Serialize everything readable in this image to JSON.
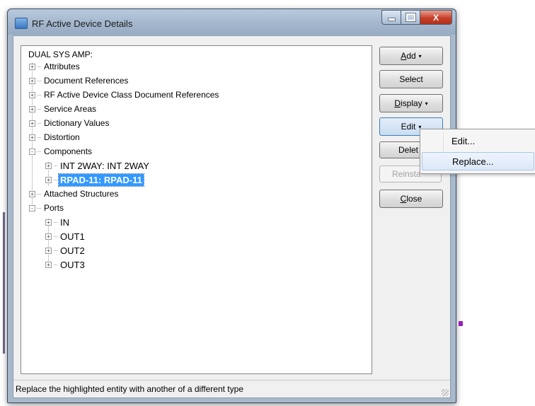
{
  "window": {
    "title": "RF Active Device Details",
    "controls": {
      "minimize": "",
      "maximize": "",
      "close": "X"
    }
  },
  "tree": {
    "root": "DUAL SYS AMP:",
    "items": [
      {
        "label": "Attributes",
        "toggle": "+"
      },
      {
        "label": "Document References",
        "toggle": "+"
      },
      {
        "label": "RF Active Device Class Document References",
        "toggle": "+"
      },
      {
        "label": "Service Areas",
        "toggle": "+"
      },
      {
        "label": "Dictionary Values",
        "toggle": "+"
      },
      {
        "label": "Distortion",
        "toggle": "+"
      },
      {
        "label": "Components",
        "toggle": "-"
      },
      {
        "label": "INT 2WAY: INT 2WAY",
        "toggle": "+"
      },
      {
        "label": "RPAD-11: RPAD-11",
        "toggle": "+",
        "selected": true
      },
      {
        "label": "Attached Structures",
        "toggle": "+"
      },
      {
        "label": "Ports",
        "toggle": "-"
      },
      {
        "label": "IN",
        "toggle": "+"
      },
      {
        "label": "OUT1",
        "toggle": "+"
      },
      {
        "label": "OUT2",
        "toggle": "+"
      },
      {
        "label": "OUT3",
        "toggle": "+"
      }
    ]
  },
  "buttons": {
    "add": {
      "mnemonic": "A",
      "rest": "dd",
      "caret": "▾"
    },
    "select": "Select",
    "display": {
      "mnemonic": "D",
      "rest": "isplay",
      "caret": "▾"
    },
    "edit": {
      "label": "Edit",
      "caret": "▾"
    },
    "delete": "Delet",
    "reinstate": "Reinsta",
    "close": {
      "mnemonic": "C",
      "rest": "lose"
    }
  },
  "context_menu": {
    "items": [
      "Edit...",
      "Replace..."
    ],
    "highlighted": "Replace..."
  },
  "status_bar": {
    "text": "Replace the highlighted entity with another of a different type"
  },
  "colors": {
    "selection": "#3399ff",
    "menu_highlight": "#dce8f8",
    "title_bar": "#a4b7cd"
  }
}
